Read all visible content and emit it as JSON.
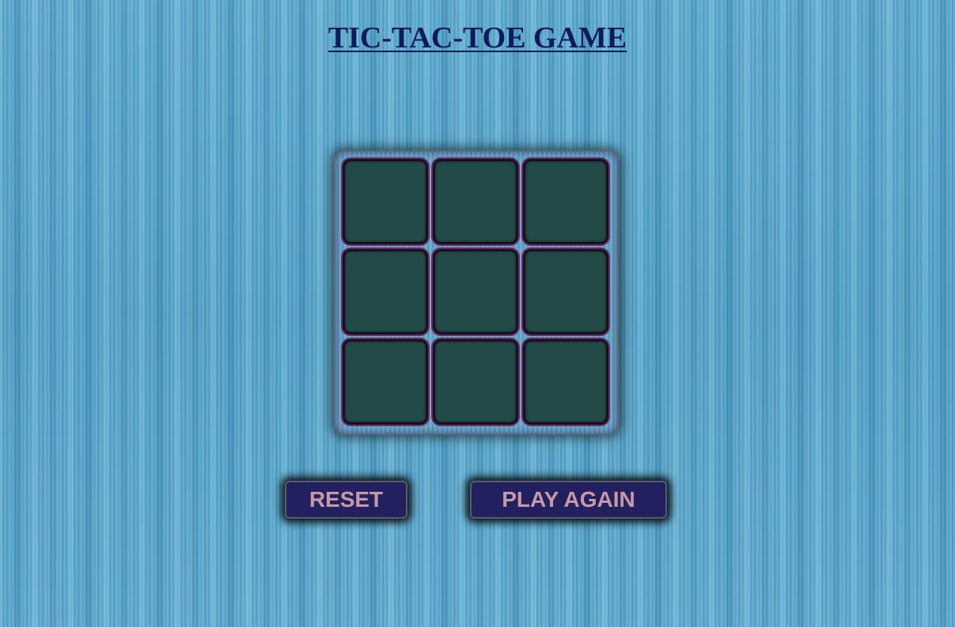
{
  "title": "TIC-TAC-TOE GAME",
  "board": {
    "cells": [
      "",
      "",
      "",
      "",
      "",
      "",
      "",
      "",
      ""
    ]
  },
  "buttons": {
    "reset_label": "RESET",
    "play_again_label": "PLAY AGAIN"
  },
  "colors": {
    "title": "#0d1a5c",
    "cell": "#214a48",
    "button_bg": "#232060",
    "button_text": "#c79aa8",
    "background": "#4f9fc4"
  }
}
